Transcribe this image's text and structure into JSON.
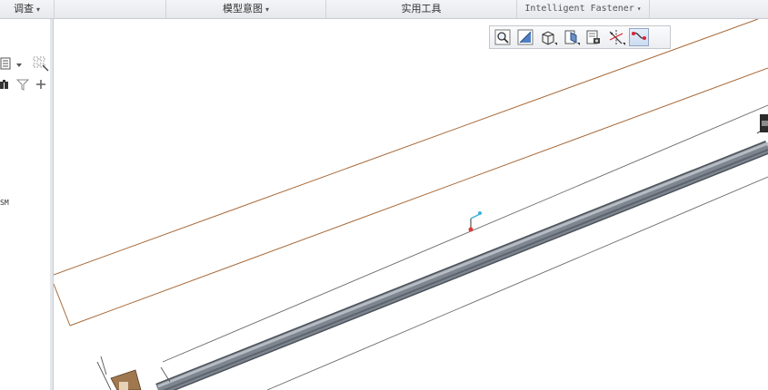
{
  "ribbon": {
    "tabs": [
      {
        "label": "调查",
        "caret": "▾"
      },
      {
        "label": "模型意图",
        "caret": "▾"
      },
      {
        "label": "实用工具",
        "caret": ""
      },
      {
        "label": "Intelligent Fastener",
        "caret": "▾"
      }
    ]
  },
  "model_tree": {
    "item_label": "SM"
  },
  "graphics_toolbar": {
    "buttons": [
      {
        "icon": "refit-zoom-icon"
      },
      {
        "icon": "repaint-icon"
      },
      {
        "icon": "display-style-icon"
      },
      {
        "icon": "saved-orientations-icon"
      },
      {
        "icon": "view-manager-icon"
      },
      {
        "icon": "datum-display-icon"
      },
      {
        "icon": "spin-center-icon"
      }
    ]
  },
  "colors": {
    "ribbon_bg": "#e6e8ec",
    "sketch_line": "#a86a3a",
    "plane_line": "#6f6f6f",
    "pipe_body": "#7d8590",
    "csys_x": "#e03a3a",
    "csys_y": "#3ab0e0"
  }
}
